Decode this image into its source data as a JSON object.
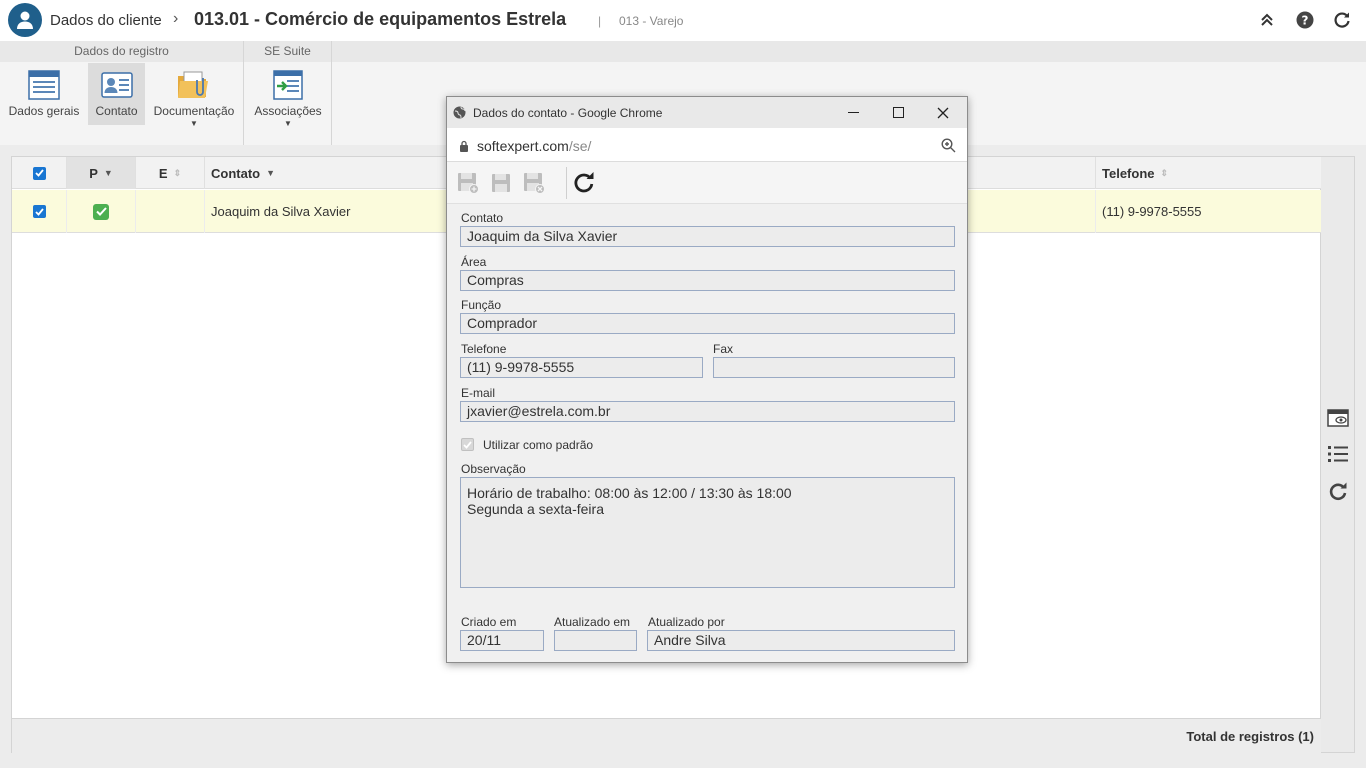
{
  "header": {
    "breadcrumb": "Dados do cliente",
    "breadcrumb_sep": "›",
    "title": "013.01 - Comércio de equipamentos Estrela",
    "title_sep": "|",
    "subtitle": "013 - Varejo"
  },
  "ribbon": {
    "groups": [
      {
        "label": "Dados do registro"
      },
      {
        "label": "SE Suite"
      }
    ],
    "buttons": {
      "dados_gerais": "Dados gerais",
      "contato": "Contato",
      "documentacao": "Documentação",
      "associacoes": "Associações"
    },
    "caret": "▼"
  },
  "grid": {
    "columns": {
      "p": "P",
      "e": "E",
      "contato": "Contato",
      "telefone": "Telefone"
    },
    "rows": [
      {
        "contato": "Joaquim da Silva Xavier",
        "telefone": "(11) 9-9978-5555",
        "selected": true,
        "padrao": true
      }
    ],
    "footer_total": "Total de registros (1)"
  },
  "popup": {
    "window_title": "Dados do contato - Google Chrome",
    "url_host": "softexpert.com",
    "url_path": "/se/",
    "fields": {
      "contato": {
        "label": "Contato",
        "value": "Joaquim da Silva Xavier"
      },
      "area": {
        "label": "Área",
        "value": "Compras"
      },
      "funcao": {
        "label": "Função",
        "value": "Comprador"
      },
      "telefone": {
        "label": "Telefone",
        "value": "(11) 9-9978-5555"
      },
      "fax": {
        "label": "Fax",
        "value": ""
      },
      "email": {
        "label": "E-mail",
        "value": "jxavier@estrela.com.br"
      },
      "padrao": {
        "label": "Utilizar como padrão",
        "checked": true
      },
      "observacao": {
        "label": "Observação",
        "line1": "Horário de trabalho: 08:00 às 12:00 / 13:30 às 18:00",
        "line2": "Segunda a sexta-feira"
      },
      "criado_em": {
        "label": "Criado em",
        "value": "20/11"
      },
      "atualizado_em": {
        "label": "Atualizado em",
        "value": ""
      },
      "atualizado_por": {
        "label": "Atualizado por",
        "value": "Andre Silva"
      }
    }
  },
  "colors": {
    "accent": "#1976d2",
    "avatar": "#1f5f8b",
    "selected_row": "#fbfbdc",
    "check_green": "#4caf50"
  }
}
